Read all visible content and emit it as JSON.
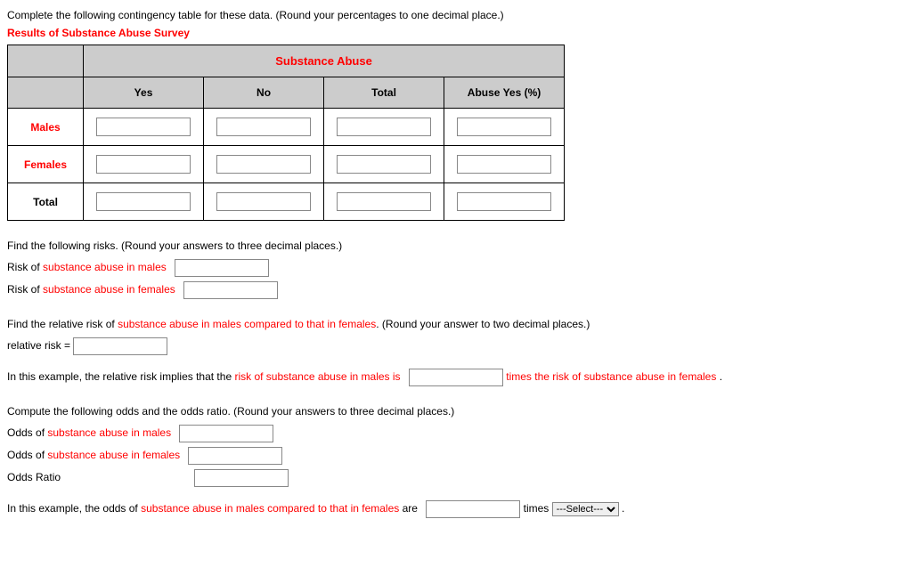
{
  "intro": "Complete the following contingency table for these data. (Round your percentages to one decimal place.)",
  "table_title": "Results of Substance Abuse Survey",
  "table": {
    "super_header": "Substance Abuse",
    "cols": {
      "yes": "Yes",
      "no": "No",
      "total": "Total",
      "pct": "Abuse Yes (%)"
    },
    "rows": {
      "males": "Males",
      "females": "Females",
      "total": "Total"
    }
  },
  "risks": {
    "intro": "Find the following risks. (Round your answers to three decimal places.)",
    "risk_of": "Risk of ",
    "males_phrase": "substance abuse in males",
    "females_phrase": "substance abuse in females"
  },
  "relrisk": {
    "intro_a": "Find the relative risk of ",
    "intro_b": "substance abuse in males compared to that in females",
    "intro_c": ". (Round your answer to two decimal places.)",
    "label": "relative risk = ",
    "implies_a": "In this example, the relative risk implies that the ",
    "implies_b": "risk of substance abuse in males is",
    "implies_c": "times the risk of substance abuse in females",
    "period": " ."
  },
  "odds": {
    "intro": "Compute the following odds and the odds ratio. (Round your answers to three decimal places.)",
    "odds_of": "Odds of ",
    "males_phrase": "substance abuse in males",
    "females_phrase": "substance abuse in females",
    "ratio_label": "Odds Ratio",
    "implies_a": "In this example, the odds of ",
    "implies_b": "substance abuse in males compared to that in females",
    "implies_c": " are ",
    "times": " times ",
    "select_placeholder": "---Select---",
    "period": " ."
  }
}
